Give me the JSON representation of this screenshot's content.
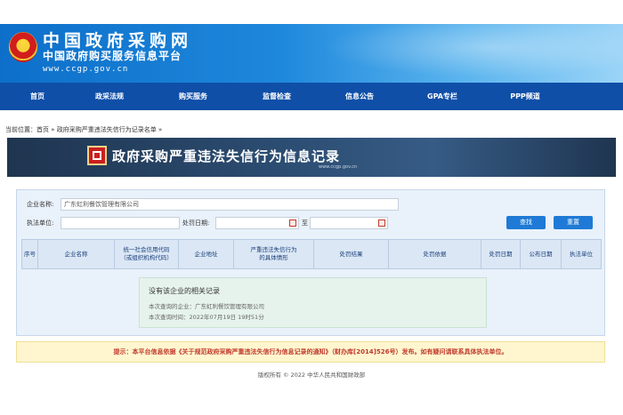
{
  "header": {
    "site_name": "中国政府采购网",
    "site_subtitle": "中国政府购买服务信息平台",
    "url": "www.ccgp.gov.cn"
  },
  "nav": {
    "items": [
      {
        "label": "首页"
      },
      {
        "label": "政采法规"
      },
      {
        "label": "购买服务"
      },
      {
        "label": "监督检查"
      },
      {
        "label": "信息公告"
      },
      {
        "label": "GPA专栏"
      },
      {
        "label": "PPP频道"
      }
    ]
  },
  "breadcrumb": {
    "prefix": "当前位置：",
    "home": "首页",
    "sep1": " » ",
    "section": "政府采购严重违法失信行为记录名单",
    "sep2": " »"
  },
  "banner": {
    "title": "政府采购严重违法失信行为信息记录",
    "subtitle": "www.ccgp.gov.cn"
  },
  "search": {
    "company_label": "企业名称:",
    "company_value": "广东虹利餐饮管理有限公司",
    "unit_label": "执法单位:",
    "unit_value": "",
    "date_label": "处罚日期:",
    "date_from": "",
    "date_to_label": "至",
    "date_to": "",
    "search_button": "查找",
    "reset_button": "重置"
  },
  "table": {
    "headers": [
      "序号",
      "企业名称",
      "统一社会信用代码\n（或组织机构代码）",
      "企业地址",
      "严重违法失信行为\n的具体情形",
      "处罚结果",
      "处罚依据",
      "处罚日期",
      "公布日期",
      "执法单位"
    ]
  },
  "result": {
    "title": "没有该企业的相关记录",
    "query_company": "本次查询的企业：广东虹利餐饮管理有限公司",
    "query_time": "本次查询时间：2022年07月19日 19时51分"
  },
  "notice": {
    "text": "提示：本平台信息依据《关于规范政府采购严重违法失信行为信息记录的通知》（财办库[2014]526号）发布。如有疑问请联系具体执法单位。"
  },
  "footer": {
    "text": "版权所有 © 2022 中华人民共和国财政部"
  },
  "colors": {
    "header_blue": "#1e88dc",
    "nav_blue": "#0f4fa8",
    "button_blue": "#1e7ad6",
    "notice_red": "#c0392b"
  }
}
